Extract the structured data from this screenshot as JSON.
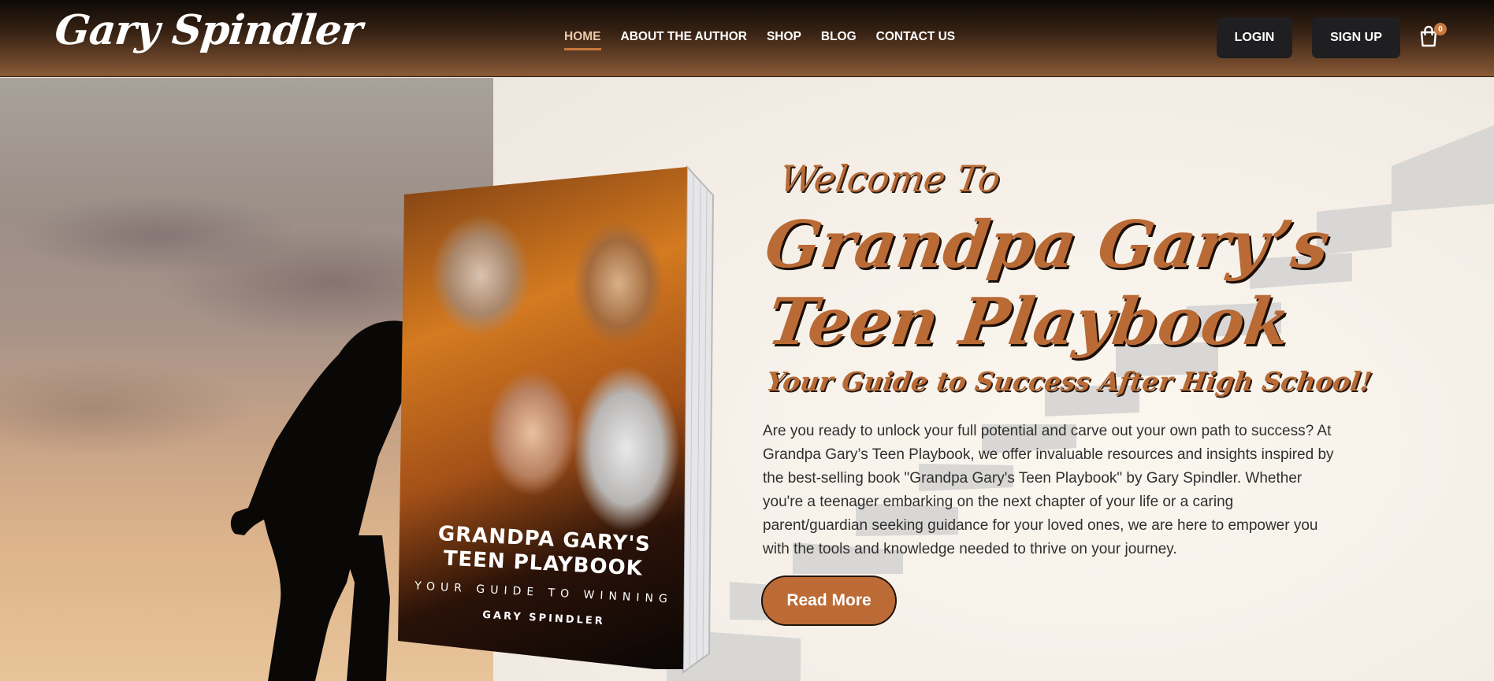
{
  "header": {
    "logo": "Gary Spindler",
    "nav": [
      {
        "label": "HOME",
        "active": true
      },
      {
        "label": "ABOUT THE AUTHOR",
        "active": false
      },
      {
        "label": "SHOP",
        "active": false
      },
      {
        "label": "BLOG",
        "active": false
      },
      {
        "label": "CONTACT US",
        "active": false
      }
    ],
    "login_label": "LOGIN",
    "signup_label": "SIGN UP",
    "cart": {
      "icon": "shopping-bag-icon",
      "count": "0"
    }
  },
  "hero": {
    "book": {
      "title": "GRANDPA GARY'S TEEN PLAYBOOK",
      "subtitle": "YOUR GUIDE TO WINNING",
      "author": "GARY SPINDLER"
    },
    "welcome": "Welcome To",
    "title_line1": "Grandpa Gary’s",
    "title_line2": "Teen Playbook",
    "tagline": "Your Guide to Success After High School!",
    "description": "Are you ready to unlock your full potential and carve out your own path to success? At Grandpa Gary’s Teen Playbook, we offer invaluable resources and insights inspired by the best-selling book \"Grandpa Gary's Teen Playbook\" by Gary Spindler. Whether you're a teenager embarking on the next chapter of your life or a caring parent/guardian seeking guidance for your loved ones, we are here to empower you with the tools and knowledge needed to thrive on your journey.",
    "cta_label": "Read More"
  },
  "colors": {
    "accent": "#bd6b36",
    "dark_button": "#1f1f22",
    "heading": "#b96a35"
  }
}
